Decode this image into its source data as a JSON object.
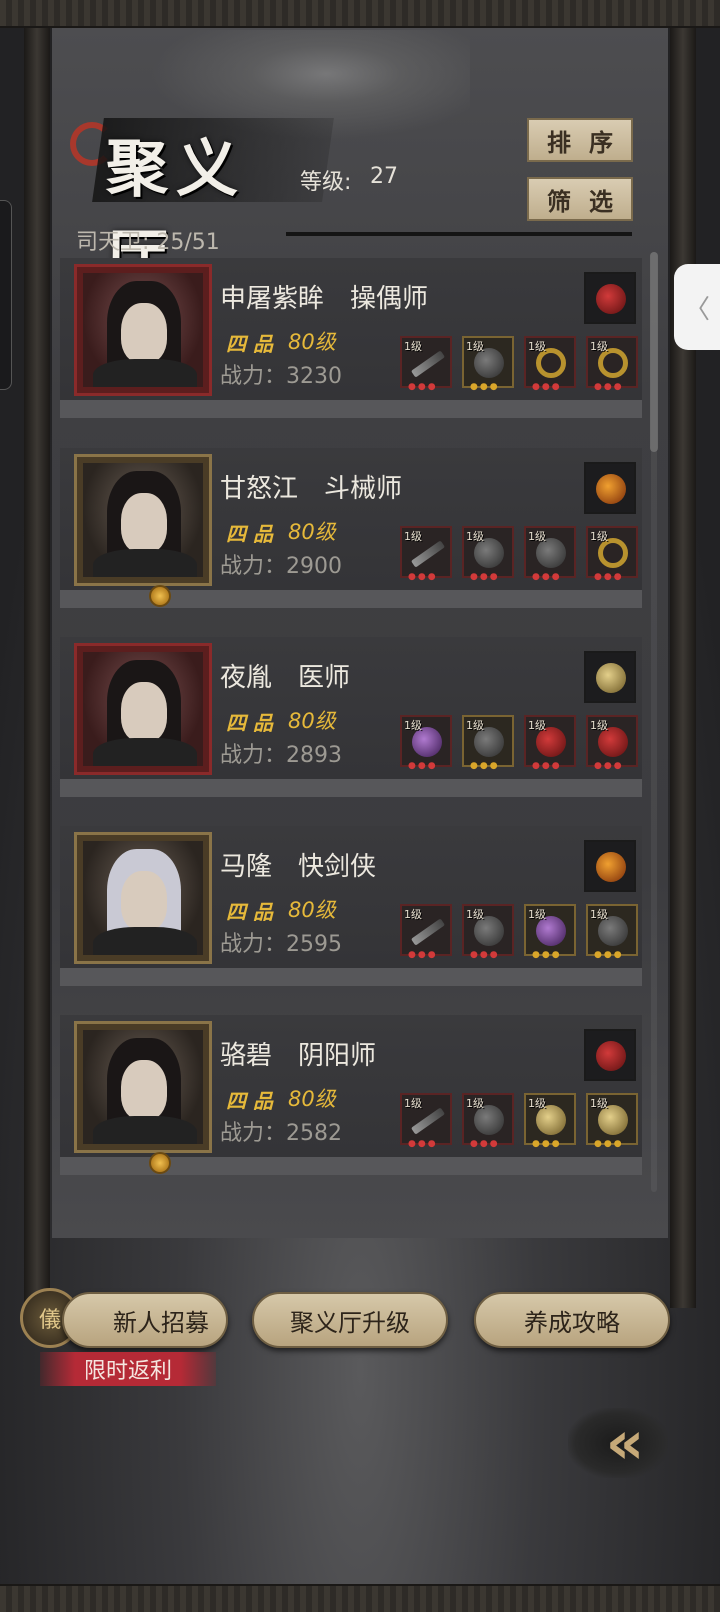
{
  "header": {
    "title": "聚义厅",
    "level_label": "等级:",
    "level_value": "27",
    "guard_count": "司天卫: 25/51",
    "sort_label": "排序",
    "filter_label": "筛选"
  },
  "side_tab": {
    "icon": "chevron-left-icon",
    "glyph": "〈"
  },
  "members": [
    {
      "name": "申屠紫眸　操偶师",
      "grade": "四 品",
      "level": "80级",
      "power": "战力：3230",
      "portrait_frame": "red",
      "special_item": "red-helmet-icon",
      "slots": [
        {
          "level": "1级",
          "icon": "spear-icon",
          "frame": "red"
        },
        {
          "level": "1级",
          "icon": "armor-icon",
          "frame": "gold"
        },
        {
          "level": "1级",
          "icon": "gold-ring-icon",
          "frame": "red"
        },
        {
          "level": "1级",
          "icon": "gold-ring-icon",
          "frame": "red"
        }
      ]
    },
    {
      "name": "甘怒江　斗械师",
      "grade": "四 品",
      "level": "80级",
      "power": "战力：2900",
      "portrait_frame": "gold",
      "special_item": "torch-icon",
      "slots": [
        {
          "level": "1级",
          "icon": "crossbow-icon",
          "frame": "red"
        },
        {
          "level": "1级",
          "icon": "armor-icon",
          "frame": "red"
        },
        {
          "level": "1级",
          "icon": "boots-icon",
          "frame": "red"
        },
        {
          "level": "1级",
          "icon": "gold-ring-icon",
          "frame": "red"
        }
      ]
    },
    {
      "name": "夜胤　医师",
      "grade": "四 品",
      "level": "80级",
      "power": "战力：2893",
      "portrait_frame": "red",
      "special_item": "bracelet-icon",
      "slots": [
        {
          "level": "1级",
          "icon": "gourd-icon",
          "frame": "red"
        },
        {
          "level": "1级",
          "icon": "armor-icon",
          "frame": "gold"
        },
        {
          "level": "1级",
          "icon": "red-helmet-icon",
          "frame": "red"
        },
        {
          "level": "1级",
          "icon": "red-helmet-icon",
          "frame": "red"
        }
      ]
    },
    {
      "name": "马隆　快剑侠",
      "grade": "四 品",
      "level": "80级",
      "power": "战力：2595",
      "portrait_frame": "gold",
      "special_item": "amber-gem-icon",
      "slots": [
        {
          "level": "1级",
          "icon": "blade-icon",
          "frame": "red"
        },
        {
          "level": "1级",
          "icon": "armor-icon",
          "frame": "red"
        },
        {
          "level": "1级",
          "icon": "gourd-icon",
          "frame": "gold"
        },
        {
          "level": "1级",
          "icon": "boots-icon",
          "frame": "gold"
        }
      ]
    },
    {
      "name": "骆碧　阴阳师",
      "grade": "四 品",
      "level": "80级",
      "power": "战力：2582",
      "portrait_frame": "gold",
      "special_item": "red-helmet-icon",
      "slots": [
        {
          "level": "1级",
          "icon": "sickle-icon",
          "frame": "red"
        },
        {
          "level": "1级",
          "icon": "armor-icon",
          "frame": "red"
        },
        {
          "level": "1级",
          "icon": "jade-pendant-icon",
          "frame": "gold"
        },
        {
          "level": "1级",
          "icon": "jade-pendant-icon",
          "frame": "gold"
        }
      ]
    }
  ],
  "footer": {
    "recruit_label": "新人招募",
    "upgrade_label": "聚义厅升级",
    "guide_label": "养成攻略",
    "promo_label": "限时返利",
    "recruit_icon_glyph": "儀",
    "back_glyph": "«"
  },
  "colors": {
    "accent_gold": "#e6b93a",
    "button_tan": "#d6c8a9",
    "promo_red": "#b52a36",
    "frame_red": "#8a2a2a",
    "frame_gold": "#8a7448"
  }
}
